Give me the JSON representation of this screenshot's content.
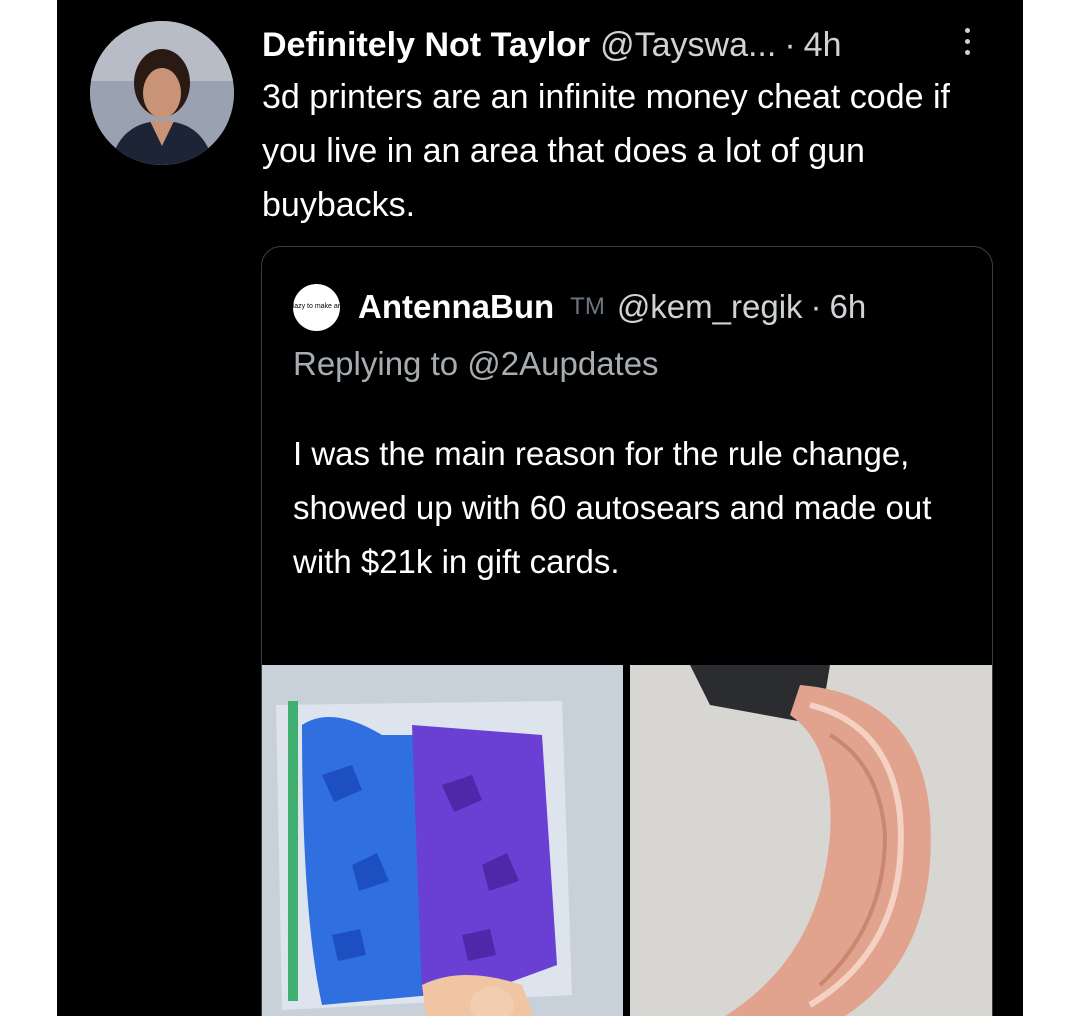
{
  "tweet": {
    "display_name": "Definitely Not Taylor",
    "handle": "@Tayswa...",
    "separator": "·",
    "time": "4h",
    "text": "3d printers are an infinite money cheat code if you live in an area that does a lot of gun buybacks."
  },
  "quoted_tweet": {
    "avatar_text": "I'm too lazy to make an avatar",
    "display_name": "AntennaBun",
    "badge": "TM",
    "handle": "@kem_regik",
    "separator": "·",
    "time": "6h",
    "replying_to": "Replying to @2Aupdates",
    "text": "I was the main reason for the rule change, showed up with 60 autosears and made out with $21k in gift cards."
  },
  "media": [
    {
      "icon": "bag-of-blue-purple-autosears-photo"
    },
    {
      "icon": "stack-of-gift-cards-photo"
    }
  ],
  "colors": {
    "background": "#000000",
    "text": "#ffffff",
    "secondary_text": "#cfd3d6",
    "border": "#3a3e44"
  }
}
